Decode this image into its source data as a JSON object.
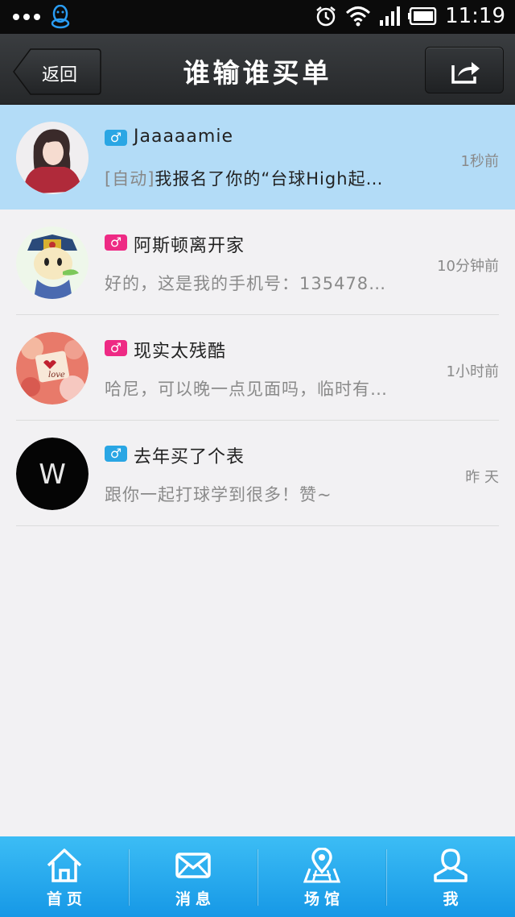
{
  "status_bar": {
    "time": "11:19",
    "icons": [
      "more-dots-icon",
      "qq-penguin-icon",
      "alarm-icon",
      "wifi-icon",
      "signal-icon",
      "battery-icon"
    ]
  },
  "header": {
    "back_label": "返回",
    "title": "谁输谁买单",
    "share_icon": "share-icon"
  },
  "conversations": [
    {
      "name": "Jaaaaamie",
      "gender": "♂",
      "gender_color": "#2aa6e4",
      "auto_tag": "[自动]",
      "message": "我报名了你的“台球High起…",
      "time": "1秒前",
      "highlighted": true
    },
    {
      "name": "阿斯顿离开家",
      "gender": "♂",
      "gender_color": "#ee2a84",
      "message": "好的，这是我的手机号：135478…",
      "time": "10分钟前"
    },
    {
      "name": "现实太残酷",
      "gender": "♂",
      "gender_color": "#ee2a84",
      "message": "哈尼，可以晚一点见面吗，临时有…",
      "time": "1小时前"
    },
    {
      "name": "去年买了个表",
      "gender": "♂",
      "gender_color": "#2aa6e4",
      "avatar_letter": "W",
      "message": "跟你一起打球学到很多！赞~",
      "time": "昨 天"
    }
  ],
  "bottom_nav": [
    {
      "label": "首页",
      "icon": "home-icon"
    },
    {
      "label": "消息",
      "icon": "mail-icon"
    },
    {
      "label": "场馆",
      "icon": "map-pin-icon"
    },
    {
      "label": "我",
      "icon": "user-icon"
    }
  ],
  "colors": {
    "accent": "#1698e6",
    "highlight_row": "#b3dcf7",
    "header_bg": "#2e3033"
  }
}
